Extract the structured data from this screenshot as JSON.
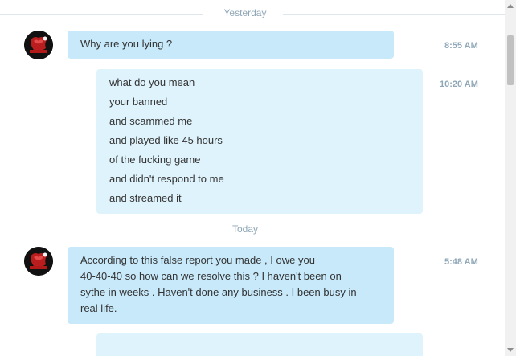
{
  "conversation": {
    "dividers": {
      "yesterday": "Yesterday",
      "today": "Today"
    },
    "messages": [
      {
        "direction": "incoming",
        "lines": [
          "Why are you lying ?"
        ],
        "time": "8:55 AM"
      },
      {
        "direction": "outgoing",
        "lines": [
          "what do you mean",
          "your banned",
          "and scammed me",
          "and played like 45 hours",
          "of the fucking game",
          "and didn't respond to me",
          "and streamed it"
        ],
        "time": "10:20 AM"
      },
      {
        "direction": "incoming",
        "lines": [
          "According to this false report you made , I owe you",
          "40-40-40 so how can we resolve this ? I haven't been on",
          "sythe in weeks . Haven't done any business . I been busy in",
          "real life."
        ],
        "time": "5:48 AM"
      }
    ]
  },
  "colors": {
    "incoming_bubble": "#c7e9fa",
    "outgoing_bubble": "#dff3fc",
    "divider_text": "#8fa7b7",
    "timestamp_text": "#8fa7b7"
  },
  "icons": {
    "avatar": "avatar-icon",
    "scroll_up": "scroll-up-arrow-icon",
    "scroll_down": "scroll-down-arrow-icon"
  }
}
